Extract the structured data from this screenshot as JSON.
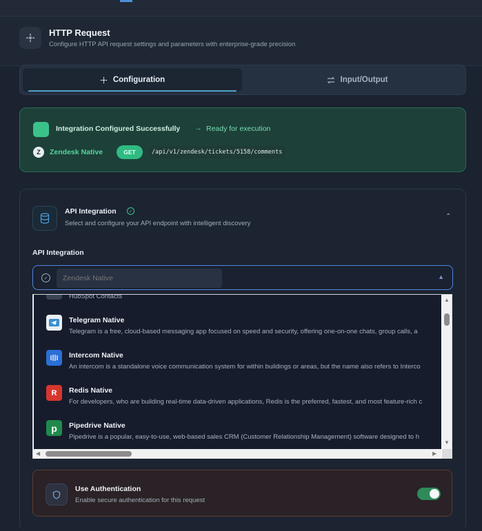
{
  "header": {
    "title": "HTTP Request",
    "subtitle": "Configure HTTP API request settings and parameters with enterprise-grade precision"
  },
  "tabs": [
    {
      "label": "Configuration",
      "active": true
    },
    {
      "label": "Input/Output",
      "active": false
    }
  ],
  "success": {
    "title": "Integration Configured Successfully",
    "status": "Ready for execution",
    "integration_name": "Zendesk Native",
    "method": "GET",
    "path": "/api/v1/zendesk/tickets/5158/comments"
  },
  "api_panel": {
    "title": "API Integration",
    "subtitle": "Select and configure your API endpoint with intelligent discovery",
    "field_label": "API Integration",
    "select_placeholder": "Zendesk Native"
  },
  "dropdown": {
    "partial_item": "HubSpot Contacts",
    "items": [
      {
        "name": "Telegram Native",
        "description": "Telegram is a free, cloud-based messaging app focused on speed and security, offering one-on-one chats, group calls, a",
        "icon": "telegram-icon",
        "color": "#3a8fd0"
      },
      {
        "name": "Intercom Native",
        "description": "An intercom is a standalone voice communication system for within buildings or areas, but the name also refers to Interco",
        "icon": "intercom-icon",
        "color": "#2b6fd6"
      },
      {
        "name": "Redis Native",
        "description": "For developers, who are building real-time data-driven applications, Redis is the preferred, fastest, and most feature-rich c",
        "icon": "redis-icon",
        "color": "#d6362f"
      },
      {
        "name": "Pipedrive Native",
        "description": "Pipedrive is a popular, easy-to-use, web-based sales CRM (Customer Relationship Management) software designed to h",
        "icon": "pipedrive-icon",
        "color": "#1f8a4c"
      }
    ]
  },
  "auth": {
    "title": "Use Authentication",
    "subtitle": "Enable secure authentication for this request",
    "enabled": true
  }
}
